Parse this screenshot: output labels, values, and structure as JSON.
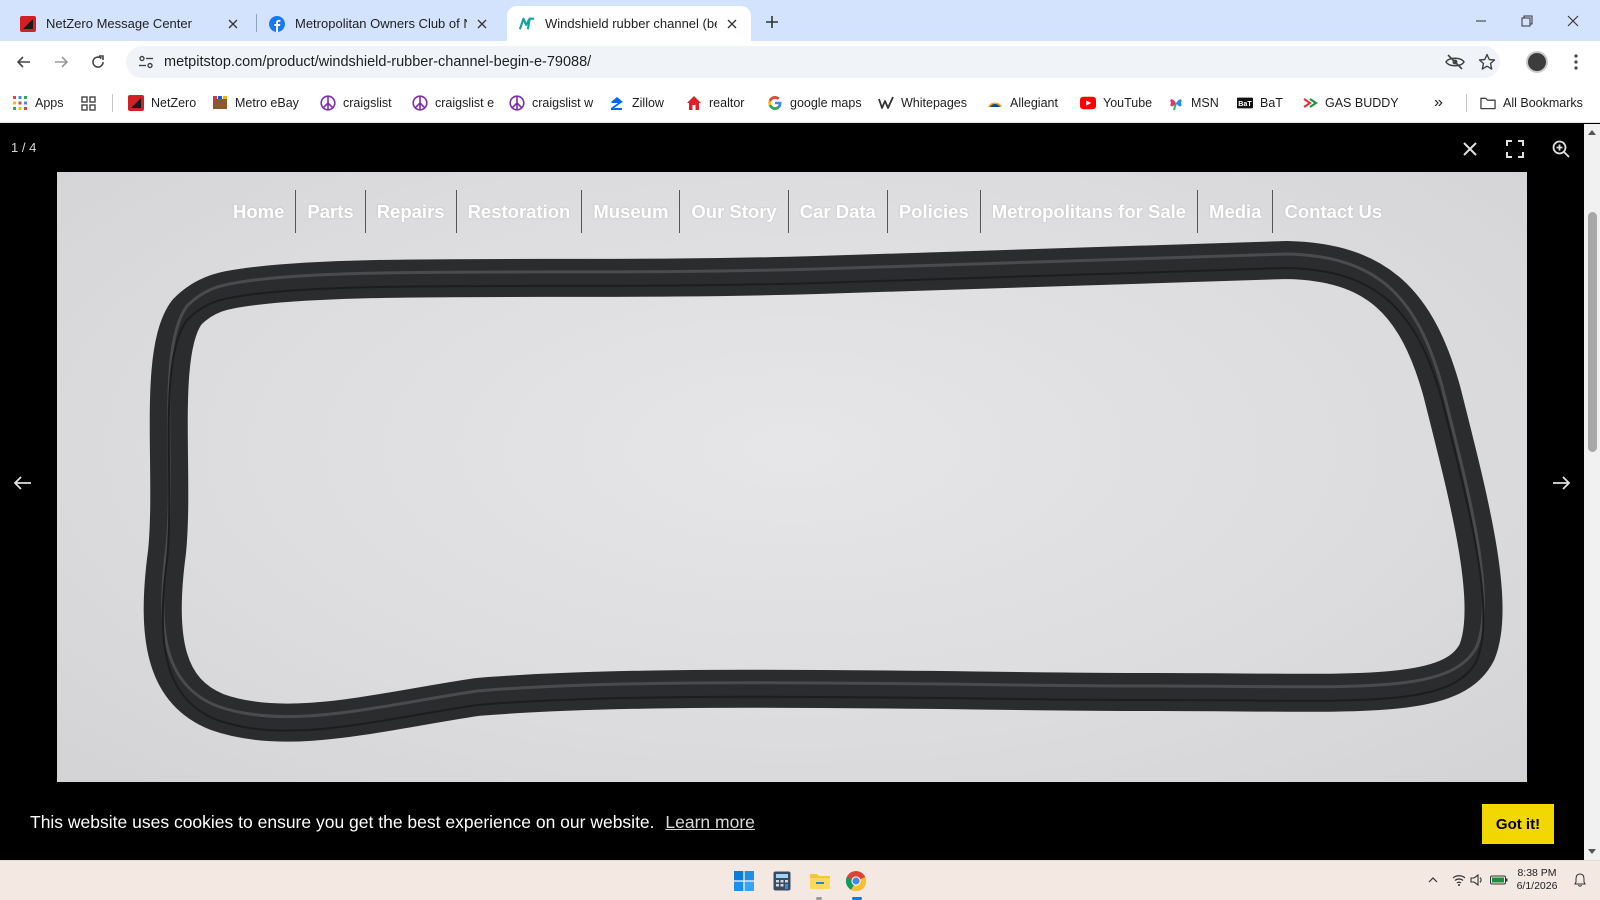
{
  "browser": {
    "tabs": [
      {
        "title": "NetZero Message Center",
        "icon": "netzero-icon",
        "active": false
      },
      {
        "title": "Metropolitan Owners Club of N",
        "icon": "facebook-icon",
        "active": false
      },
      {
        "title": "Windshield rubber channel (beg",
        "icon": "metpitstop-icon",
        "active": true
      }
    ],
    "url": "metpitstop.com/product/windshield-rubber-channel-begin-e-79088/",
    "bookmarks": [
      {
        "label": "Apps",
        "icon": "apps-grid-icon"
      },
      {
        "label": "NetZero",
        "icon": "netzero-icon"
      },
      {
        "label": "Metro eBay",
        "icon": "metro-ebay-icon"
      },
      {
        "label": "craigslist",
        "icon": "peace-icon"
      },
      {
        "label": "craigslist e",
        "icon": "peace-icon"
      },
      {
        "label": "craigslist w",
        "icon": "peace-icon"
      },
      {
        "label": "Zillow",
        "icon": "zillow-icon"
      },
      {
        "label": "realtor",
        "icon": "realtor-icon"
      },
      {
        "label": "google maps",
        "icon": "google-icon"
      },
      {
        "label": "Whitepages",
        "icon": "whitepages-icon"
      },
      {
        "label": "Allegiant",
        "icon": "allegiant-icon"
      },
      {
        "label": "YouTube",
        "icon": "youtube-icon"
      },
      {
        "label": "MSN",
        "icon": "msn-icon"
      },
      {
        "label": "BaT",
        "icon": "bat-icon"
      },
      {
        "label": "GAS BUDDY",
        "icon": "gasbuddy-icon"
      }
    ],
    "all_bookmarks": "All Bookmarks",
    "more_bookmarks": "»"
  },
  "viewer": {
    "counter": "1 / 4",
    "site_nav": [
      "Home",
      "Parts",
      "Repairs",
      "Restoration",
      "Museum",
      "Our Story",
      "Car Data",
      "Policies",
      "Metropolitans for Sale",
      "Media",
      "Contact Us"
    ],
    "image_subject": "black rubber windshield channel gasket"
  },
  "cookie": {
    "message": "This website uses cookies to ensure you get the best experience on our website.",
    "link": "Learn more",
    "button": "Got it!"
  },
  "taskbar": {
    "apps": [
      "start-icon",
      "calculator-icon",
      "file-explorer-icon",
      "chrome-icon"
    ],
    "time": "8:38 PM",
    "date": "6/1/2026"
  },
  "colors": {
    "tabstrip": "#d3e3fd",
    "cookie_button": "#f1d600",
    "viewer_bg": "#000000",
    "taskbar": "#f3e8e2"
  }
}
